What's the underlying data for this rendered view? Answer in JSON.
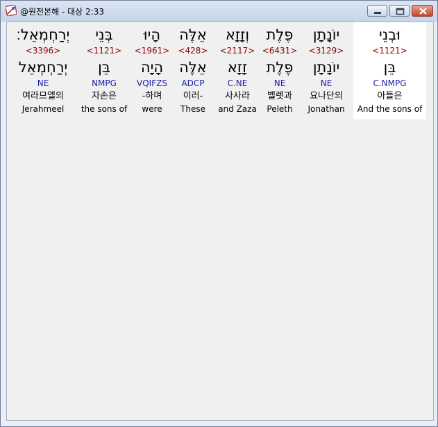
{
  "window": {
    "title": "@원전본해 - 대상 2:33"
  },
  "columns": [
    {
      "hebrew": "וּבְנֵי",
      "strong": "<1121>",
      "lemma": "בֵּן",
      "parsing": "C.NMPG",
      "korean": "아들은",
      "english": "And the sons of"
    },
    {
      "hebrew": "יוֹנָתָן",
      "strong": "<3129>",
      "lemma": "יוֹנָתָן",
      "parsing": "NE",
      "korean": "요나단의",
      "english": "Jonathan"
    },
    {
      "hebrew": "פֶּלֶת",
      "strong": "<6431>",
      "lemma": "פֶּלֶת",
      "parsing": "NE",
      "korean": "벨렛과",
      "english": "Peleth"
    },
    {
      "hebrew": "וְזָזָא",
      "strong": "<2117>",
      "lemma": "זָזָא",
      "parsing": "C.NE",
      "korean": "사사라",
      "english": "and Zaza"
    },
    {
      "hebrew": "אֵלֶּה",
      "strong": "<428>",
      "lemma": "אֵלֶּה",
      "parsing": "ADCP",
      "korean": "이러-",
      "english": "These"
    },
    {
      "hebrew": "הָיוּ",
      "strong": "<1961>",
      "lemma": "הָיָה",
      "parsing": "VQIFZS",
      "korean": "-하며",
      "english": "were"
    },
    {
      "hebrew": "בְּנֵי",
      "strong": "<1121>",
      "lemma": "בֵּן",
      "parsing": "NMPG",
      "korean": "자손은",
      "english": "the sons of"
    },
    {
      "hebrew": "יְרַחְמְאֵל׃",
      "strong": "<3396>",
      "lemma": "יְרַחְמְאֵל",
      "parsing": "NE",
      "korean": "여라므엘의",
      "english": "Jerahmeel"
    }
  ],
  "colors": {
    "strong": "#8b0000",
    "parsing": "#1c1cb0",
    "selected_bg": "#ffffff",
    "client_bg": "#f0f0f0"
  }
}
